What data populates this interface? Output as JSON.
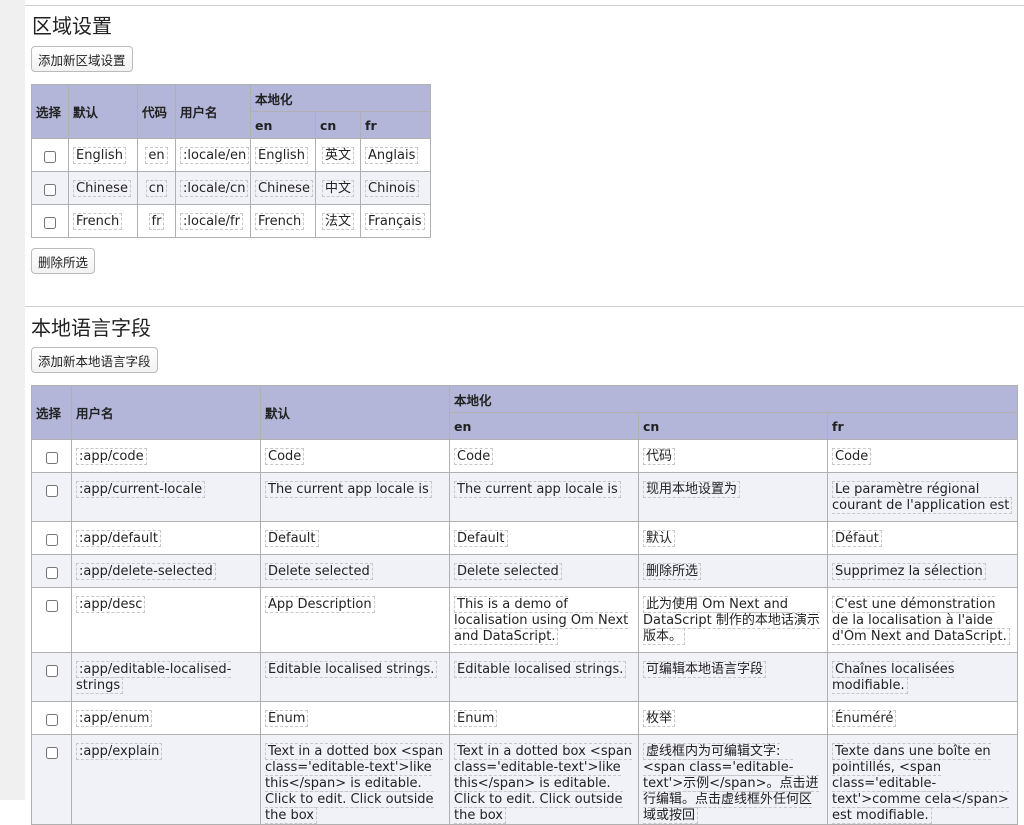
{
  "locales_section": {
    "title": "区域设置",
    "add_button": "添加新区域设置",
    "delete_button": "删除所选",
    "headers": {
      "select": "选择",
      "default": "默认",
      "code": "代码",
      "username": "用户名",
      "localised": "本地化",
      "en": "en",
      "cn": "cn",
      "fr": "fr"
    },
    "rows": [
      {
        "default": "English",
        "code": "en",
        "username": ":locale/en",
        "en": "English",
        "cn": "英文",
        "fr": "Anglais"
      },
      {
        "default": "Chinese",
        "code": "cn",
        "username": ":locale/cn",
        "en": "Chinese",
        "cn": "中文",
        "fr": "Chinois"
      },
      {
        "default": "French",
        "code": "fr",
        "username": ":locale/fr",
        "en": "French",
        "cn": "法文",
        "fr": "Français"
      }
    ]
  },
  "strings_section": {
    "title": "本地语言字段",
    "add_button": "添加新本地语言字段",
    "headers": {
      "select": "选择",
      "username": "用户名",
      "default": "默认",
      "localised": "本地化",
      "en": "en",
      "cn": "cn",
      "fr": "fr"
    },
    "rows": [
      {
        "key": ":app/code",
        "default": "Code",
        "en": "Code",
        "cn": "代码",
        "fr": "Code"
      },
      {
        "key": ":app/current-locale",
        "default": "The current app locale is",
        "en": "The current app locale is",
        "cn": "现用本地设置为",
        "fr": "Le paramètre régional courant de l'application est"
      },
      {
        "key": ":app/default",
        "default": "Default",
        "en": "Default",
        "cn": "默认",
        "fr": "Défaut"
      },
      {
        "key": ":app/delete-selected",
        "default": "Delete selected",
        "en": "Delete selected",
        "cn": "删除所选",
        "fr": "Supprimez la sélection"
      },
      {
        "key": ":app/desc",
        "default": "App Description",
        "en": "This is a demo of localisation using Om Next and DataScript.",
        "cn": "此为使用 Om Next and DataScript 制作的本地话演示版本。",
        "fr": "C'est une démonstration de la localisation à l'aide d'Om Next and DataScript."
      },
      {
        "key": ":app/editable-localised-strings",
        "default": "Editable localised strings.",
        "en": "Editable localised strings.",
        "cn": "可编辑本地语言字段",
        "fr": "Chaînes localisées modifiable."
      },
      {
        "key": ":app/enum",
        "default": "Enum",
        "en": "Enum",
        "cn": "枚举",
        "fr": "Énuméré"
      },
      {
        "key": ":app/explain",
        "default": "Text in a dotted box <span class='editable-text'>like this</span> is editable. Click to edit. Click outside the box",
        "en": "Text in a dotted box <span class='editable-text'>like this</span> is editable. Click to edit. Click outside the box",
        "cn": "虚线框内为可编辑文字: <span class='editable-text'>示例</span>。点击进行编辑。点击虚线框外任何区域或按回",
        "fr": "Texte dans une boîte en pointillés, <span class='editable-text'>comme cela</span> est modifiable."
      }
    ]
  }
}
